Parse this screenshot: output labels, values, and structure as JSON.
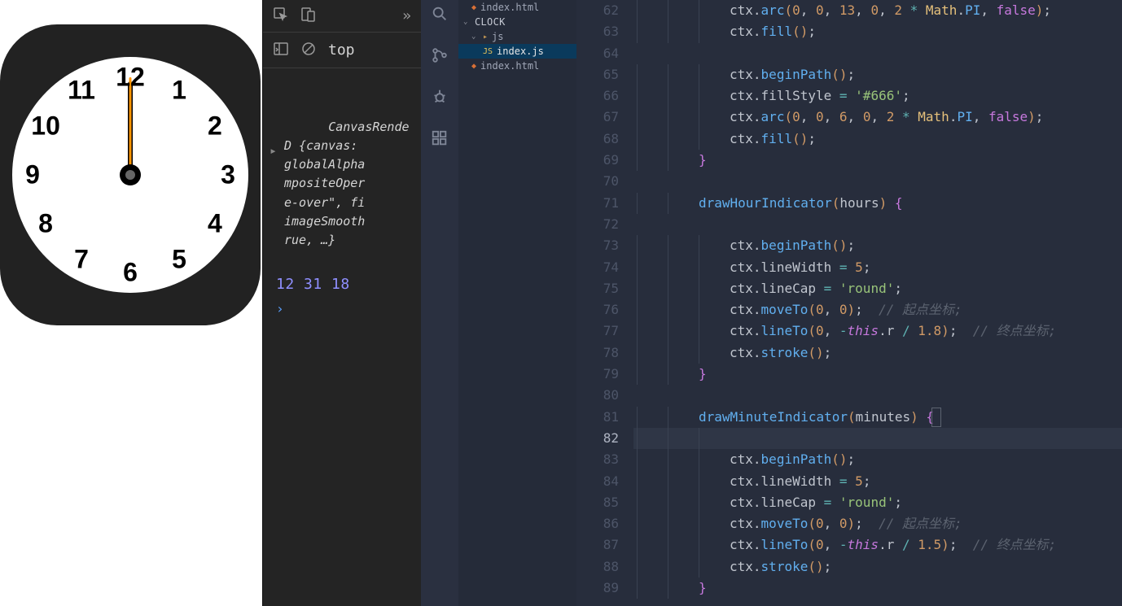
{
  "clock": {
    "numerals": [
      "12",
      "1",
      "2",
      "3",
      "4",
      "5",
      "6",
      "7",
      "8",
      "9",
      "10",
      "11"
    ],
    "hands": {
      "hour_deg": 0,
      "minute_deg": 0,
      "second_deg": 0
    },
    "colors": {
      "bg": "#222",
      "face": "#fff",
      "second": "#ff9500",
      "pin_inner": "#666"
    }
  },
  "devtools": {
    "toolbar_overflow": "»",
    "context": "top",
    "console_object_text": "CanvasRende\nD {canvas: \nglobalAlpha\nmpositeOper\ne-over\", fi\nimageSmooth\nrue, …}",
    "console_values": "12 31 18",
    "prompt": "›"
  },
  "explorer": {
    "files": [
      {
        "name": "index.html",
        "type": "html",
        "indent": 2
      },
      {
        "name": "index.js",
        "type": "js",
        "indent": 2,
        "selected": false
      }
    ],
    "root": "CLOCK",
    "folder_js": "js",
    "file_indexjs": "index.js",
    "file_indexhtml_top": "index.html",
    "file_indexhtml_bottom": "index.html"
  },
  "editor": {
    "active_file": "index.js",
    "first_line_no": 62,
    "active_line_no": 82,
    "lines": [
      {
        "n": 62,
        "ind": 3,
        "seg": [
          [
            "obj",
            "ctx"
          ],
          [
            "punc",
            "."
          ],
          [
            "prop",
            "arc"
          ],
          [
            "par",
            "("
          ],
          [
            "num",
            "0"
          ],
          [
            "punc",
            ", "
          ],
          [
            "num",
            "0"
          ],
          [
            "punc",
            ", "
          ],
          [
            "num",
            "13"
          ],
          [
            "punc",
            ", "
          ],
          [
            "num",
            "0"
          ],
          [
            "punc",
            ", "
          ],
          [
            "num",
            "2"
          ],
          [
            "punc",
            " "
          ],
          [
            "op",
            "*"
          ],
          [
            "punc",
            " "
          ],
          [
            "cls",
            "Math"
          ],
          [
            "punc",
            "."
          ],
          [
            "prop",
            "PI"
          ],
          [
            "punc",
            ", "
          ],
          [
            "kw",
            "false"
          ],
          [
            "par",
            ")"
          ],
          [
            "punc",
            ";"
          ]
        ]
      },
      {
        "n": 63,
        "ind": 3,
        "seg": [
          [
            "obj",
            "ctx"
          ],
          [
            "punc",
            "."
          ],
          [
            "prop",
            "fill"
          ],
          [
            "par",
            "()"
          ],
          [
            "punc",
            ";"
          ]
        ]
      },
      {
        "n": 64,
        "ind": 0,
        "seg": []
      },
      {
        "n": 65,
        "ind": 3,
        "seg": [
          [
            "obj",
            "ctx"
          ],
          [
            "punc",
            "."
          ],
          [
            "prop",
            "beginPath"
          ],
          [
            "par",
            "()"
          ],
          [
            "punc",
            ";"
          ]
        ]
      },
      {
        "n": 66,
        "ind": 3,
        "seg": [
          [
            "obj",
            "ctx"
          ],
          [
            "punc",
            "."
          ],
          [
            "obj",
            "fillStyle"
          ],
          [
            "punc",
            " "
          ],
          [
            "op",
            "="
          ],
          [
            "punc",
            " "
          ],
          [
            "str",
            "'#666'"
          ],
          [
            "punc",
            ";"
          ]
        ]
      },
      {
        "n": 67,
        "ind": 3,
        "seg": [
          [
            "obj",
            "ctx"
          ],
          [
            "punc",
            "."
          ],
          [
            "prop",
            "arc"
          ],
          [
            "par",
            "("
          ],
          [
            "num",
            "0"
          ],
          [
            "punc",
            ", "
          ],
          [
            "num",
            "0"
          ],
          [
            "punc",
            ", "
          ],
          [
            "num",
            "6"
          ],
          [
            "punc",
            ", "
          ],
          [
            "num",
            "0"
          ],
          [
            "punc",
            ", "
          ],
          [
            "num",
            "2"
          ],
          [
            "punc",
            " "
          ],
          [
            "op",
            "*"
          ],
          [
            "punc",
            " "
          ],
          [
            "cls",
            "Math"
          ],
          [
            "punc",
            "."
          ],
          [
            "prop",
            "PI"
          ],
          [
            "punc",
            ", "
          ],
          [
            "kw",
            "false"
          ],
          [
            "par",
            ")"
          ],
          [
            "punc",
            ";"
          ]
        ]
      },
      {
        "n": 68,
        "ind": 3,
        "seg": [
          [
            "obj",
            "ctx"
          ],
          [
            "punc",
            "."
          ],
          [
            "prop",
            "fill"
          ],
          [
            "par",
            "()"
          ],
          [
            "punc",
            ";"
          ]
        ]
      },
      {
        "n": 69,
        "ind": 2,
        "seg": [
          [
            "br",
            "}"
          ]
        ]
      },
      {
        "n": 70,
        "ind": 0,
        "seg": []
      },
      {
        "n": 71,
        "ind": 2,
        "seg": [
          [
            "fn",
            "drawHourIndicator"
          ],
          [
            "par",
            "("
          ],
          [
            "obj",
            "hours"
          ],
          [
            "par",
            ")"
          ],
          [
            "punc",
            " "
          ],
          [
            "br",
            "{"
          ]
        ]
      },
      {
        "n": 72,
        "ind": 0,
        "seg": []
      },
      {
        "n": 73,
        "ind": 3,
        "seg": [
          [
            "obj",
            "ctx"
          ],
          [
            "punc",
            "."
          ],
          [
            "prop",
            "beginPath"
          ],
          [
            "par",
            "()"
          ],
          [
            "punc",
            ";"
          ]
        ]
      },
      {
        "n": 74,
        "ind": 3,
        "seg": [
          [
            "obj",
            "ctx"
          ],
          [
            "punc",
            "."
          ],
          [
            "obj",
            "lineWidth"
          ],
          [
            "punc",
            " "
          ],
          [
            "op",
            "="
          ],
          [
            "punc",
            " "
          ],
          [
            "num",
            "5"
          ],
          [
            "punc",
            ";"
          ]
        ]
      },
      {
        "n": 75,
        "ind": 3,
        "seg": [
          [
            "obj",
            "ctx"
          ],
          [
            "punc",
            "."
          ],
          [
            "obj",
            "lineCap"
          ],
          [
            "punc",
            " "
          ],
          [
            "op",
            "="
          ],
          [
            "punc",
            " "
          ],
          [
            "str",
            "'round'"
          ],
          [
            "punc",
            ";"
          ]
        ]
      },
      {
        "n": 76,
        "ind": 3,
        "seg": [
          [
            "obj",
            "ctx"
          ],
          [
            "punc",
            "."
          ],
          [
            "prop",
            "moveTo"
          ],
          [
            "par",
            "("
          ],
          [
            "num",
            "0"
          ],
          [
            "punc",
            ", "
          ],
          [
            "num",
            "0"
          ],
          [
            "par",
            ")"
          ],
          [
            "punc",
            ";  "
          ],
          [
            "cmt",
            "// 起点坐标;"
          ]
        ]
      },
      {
        "n": 77,
        "ind": 3,
        "seg": [
          [
            "obj",
            "ctx"
          ],
          [
            "punc",
            "."
          ],
          [
            "prop",
            "lineTo"
          ],
          [
            "par",
            "("
          ],
          [
            "num",
            "0"
          ],
          [
            "punc",
            ", "
          ],
          [
            "op",
            "-"
          ],
          [
            "kw",
            "this"
          ],
          [
            "punc",
            "."
          ],
          [
            "obj",
            "r"
          ],
          [
            "punc",
            " "
          ],
          [
            "op",
            "/"
          ],
          [
            "punc",
            " "
          ],
          [
            "num",
            "1.8"
          ],
          [
            "par",
            ")"
          ],
          [
            "punc",
            ";  "
          ],
          [
            "cmt",
            "// 终点坐标;"
          ]
        ]
      },
      {
        "n": 78,
        "ind": 3,
        "seg": [
          [
            "obj",
            "ctx"
          ],
          [
            "punc",
            "."
          ],
          [
            "prop",
            "stroke"
          ],
          [
            "par",
            "()"
          ],
          [
            "punc",
            ";"
          ]
        ]
      },
      {
        "n": 79,
        "ind": 2,
        "seg": [
          [
            "br",
            "}"
          ]
        ]
      },
      {
        "n": 80,
        "ind": 0,
        "seg": []
      },
      {
        "n": 81,
        "ind": 2,
        "seg": [
          [
            "fn",
            "drawMinuteIndicator"
          ],
          [
            "par",
            "("
          ],
          [
            "obj",
            "minutes"
          ],
          [
            "par",
            ")"
          ],
          [
            "punc",
            " "
          ],
          [
            "br",
            "{"
          ],
          [
            "cursor",
            ""
          ]
        ]
      },
      {
        "n": 82,
        "ind": 3,
        "seg": [],
        "active": true
      },
      {
        "n": 83,
        "ind": 3,
        "seg": [
          [
            "obj",
            "ctx"
          ],
          [
            "punc",
            "."
          ],
          [
            "prop",
            "beginPath"
          ],
          [
            "par",
            "()"
          ],
          [
            "punc",
            ";"
          ]
        ]
      },
      {
        "n": 84,
        "ind": 3,
        "seg": [
          [
            "obj",
            "ctx"
          ],
          [
            "punc",
            "."
          ],
          [
            "obj",
            "lineWidth"
          ],
          [
            "punc",
            " "
          ],
          [
            "op",
            "="
          ],
          [
            "punc",
            " "
          ],
          [
            "num",
            "5"
          ],
          [
            "punc",
            ";"
          ]
        ]
      },
      {
        "n": 85,
        "ind": 3,
        "seg": [
          [
            "obj",
            "ctx"
          ],
          [
            "punc",
            "."
          ],
          [
            "obj",
            "lineCap"
          ],
          [
            "punc",
            " "
          ],
          [
            "op",
            "="
          ],
          [
            "punc",
            " "
          ],
          [
            "str",
            "'round'"
          ],
          [
            "punc",
            ";"
          ]
        ]
      },
      {
        "n": 86,
        "ind": 3,
        "seg": [
          [
            "obj",
            "ctx"
          ],
          [
            "punc",
            "."
          ],
          [
            "prop",
            "moveTo"
          ],
          [
            "par",
            "("
          ],
          [
            "num",
            "0"
          ],
          [
            "punc",
            ", "
          ],
          [
            "num",
            "0"
          ],
          [
            "par",
            ")"
          ],
          [
            "punc",
            ";  "
          ],
          [
            "cmt",
            "// 起点坐标;"
          ]
        ]
      },
      {
        "n": 87,
        "ind": 3,
        "seg": [
          [
            "obj",
            "ctx"
          ],
          [
            "punc",
            "."
          ],
          [
            "prop",
            "lineTo"
          ],
          [
            "par",
            "("
          ],
          [
            "num",
            "0"
          ],
          [
            "punc",
            ", "
          ],
          [
            "op",
            "-"
          ],
          [
            "kw",
            "this"
          ],
          [
            "punc",
            "."
          ],
          [
            "obj",
            "r"
          ],
          [
            "punc",
            " "
          ],
          [
            "op",
            "/"
          ],
          [
            "punc",
            " "
          ],
          [
            "num",
            "1.5"
          ],
          [
            "par",
            ")"
          ],
          [
            "punc",
            ";  "
          ],
          [
            "cmt",
            "// 终点坐标;"
          ]
        ]
      },
      {
        "n": 88,
        "ind": 3,
        "seg": [
          [
            "obj",
            "ctx"
          ],
          [
            "punc",
            "."
          ],
          [
            "prop",
            "stroke"
          ],
          [
            "par",
            "()"
          ],
          [
            "punc",
            ";"
          ]
        ]
      },
      {
        "n": 89,
        "ind": 2,
        "seg": [
          [
            "br",
            "}"
          ]
        ]
      }
    ]
  }
}
